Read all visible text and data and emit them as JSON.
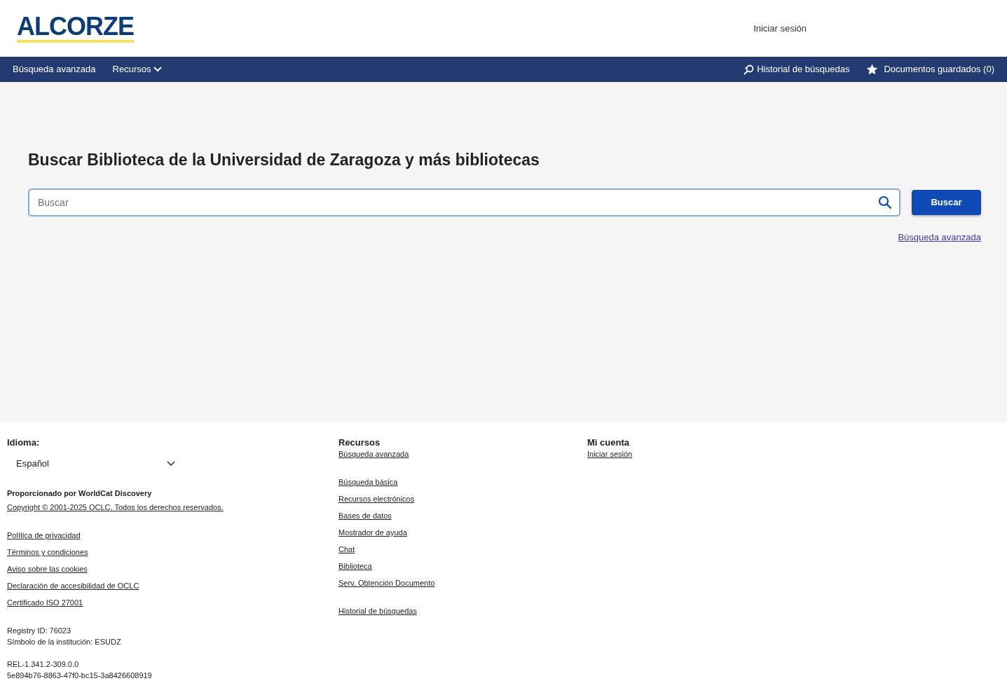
{
  "header": {
    "logo": "ALCORZE",
    "sign_in": "Iniciar sesión"
  },
  "nav": {
    "left": [
      {
        "label": "Búsqueda avanzada",
        "kind": "link"
      },
      {
        "label": "Recursos",
        "kind": "dropdown"
      }
    ],
    "right": [
      {
        "label": "Historial de búsquedas",
        "kind": "history"
      },
      {
        "label": "Documentos guardados (0)",
        "kind": "star"
      }
    ]
  },
  "search": {
    "title": "Buscar Biblioteca de la Universidad de Zaragoza y más bibliotecas",
    "placeholder": "Buscar",
    "button": "Buscar",
    "advanced_link": "Búsqueda avanzada"
  },
  "footer": {
    "language_label": "Idioma:",
    "language": "Español",
    "powered_by": "Proporcionado por WorldCat Discovery",
    "copyright": "Copyright © 2001-2025 OCLC. Todos los derechos reservados.",
    "legal_links": [
      "Política de privacidad",
      "Términos y condiciones",
      "Aviso sobre las cookies",
      "Declaración de accesibilidad de OCLC",
      "Certificado ISO 27001"
    ],
    "registry": [
      "Registry ID: 76023",
      "Símbolo de la institución: ESUDZ"
    ],
    "build": [
      "REL-1.341.2-309.0.0",
      "5e894b76-8863-47f0-bc15-3a8426608919"
    ],
    "columns": [
      {
        "title": "Recursos",
        "groups": [
          [
            "Búsqueda avanzada"
          ],
          [
            "Búsqueda básica",
            "Recursos electrónicos",
            "Bases de datos",
            "Mostrador de ayuda",
            "Chat",
            "Biblioteca",
            "Serv. Obtención Documento"
          ],
          [
            "Historial de búsquedas"
          ]
        ]
      },
      {
        "title": "Mi cuenta",
        "groups": [
          [
            "Iniciar sesión"
          ]
        ]
      }
    ]
  }
}
